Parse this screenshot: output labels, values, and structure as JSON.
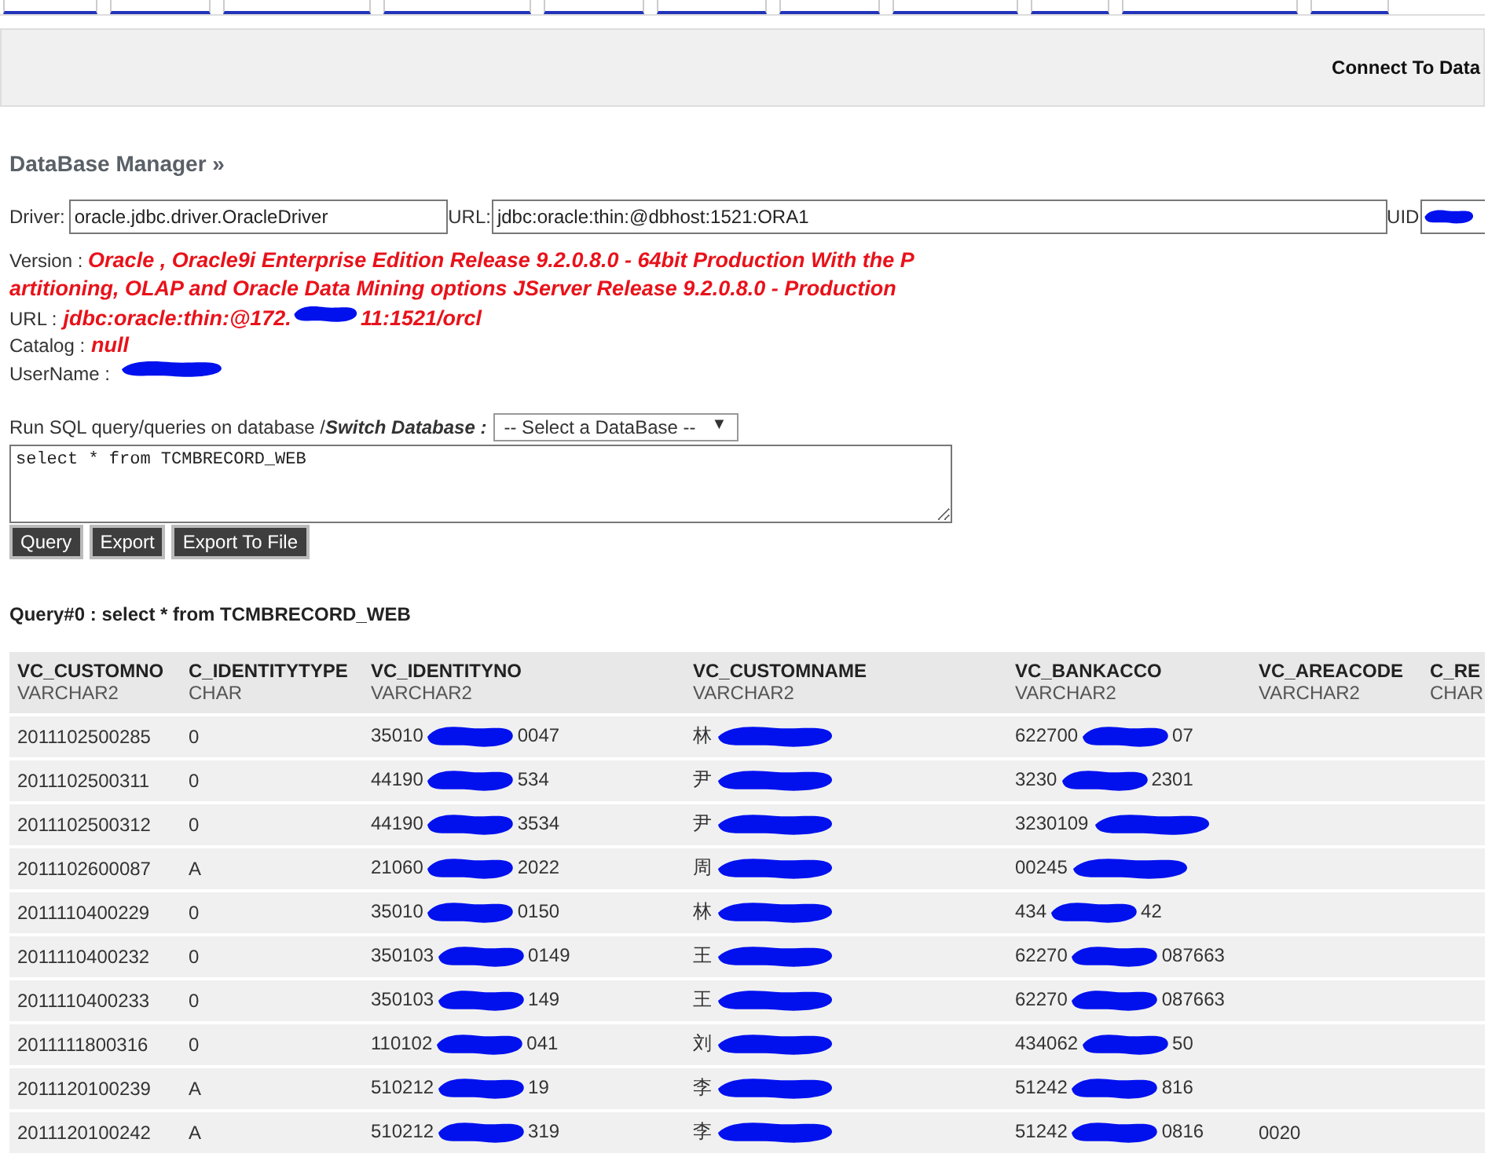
{
  "connect_bar": {
    "label": "Connect To Data"
  },
  "heading": "DataBase Manager »",
  "connection": {
    "driver_label": "Driver:",
    "driver": "oracle.jdbc.driver.OracleDriver",
    "url_label": "URL:",
    "url": "jdbc:oracle:thin:@dbhost:1521:ORA1",
    "uid_label": "UID"
  },
  "info": [
    {
      "label": "Version :",
      "before": "Oracle , Oracle9i Enterprise Edition Release 9.2.0.8.0 - 64bit Production With the P artitioning, OLAP and Oracle Data Mining options JServer Release 9.2.0.8.0 - Production",
      "redacted": false
    },
    {
      "label": "URL :",
      "before": "jdbc:oracle:thin:@172.",
      "after": "11:1521/orcl",
      "redacted": true
    },
    {
      "label": "Catalog :",
      "before": "null",
      "redacted": false
    },
    {
      "label": "UserName :",
      "redacted": true
    }
  ],
  "sql": {
    "prompt": "Run SQL query/queries on database / ",
    "switch_label": "Switch Database :",
    "select": "-- Select a DataBase --",
    "select_arrow": "▼",
    "query": "select * from TCMBRECORD_WEB",
    "buttons": [
      "Query",
      "Export",
      "Export To File"
    ]
  },
  "result_title": "Query#0 : select * from TCMBRECORD_WEB",
  "table": {
    "columns": [
      {
        "name": "VC_CUSTOMNO",
        "type": "VARCHAR2"
      },
      {
        "name": "C_IDENTITYTYPE",
        "type": "CHAR"
      },
      {
        "name": "VC_IDENTITYNO",
        "type": "VARCHAR2"
      },
      {
        "name": "VC_CUSTOMNAME",
        "type": "VARCHAR2"
      },
      {
        "name": "VC_BANKACCO",
        "type": "VARCHAR2"
      },
      {
        "name": "VC_AREACODE",
        "type": "VARCHAR2"
      },
      {
        "name": "C_RE",
        "type": "CHAR"
      }
    ],
    "rows": [
      {
        "cells": [
          "2011102500285",
          "0",
          {
            "before": "35010",
            "after": "0047"
          },
          {
            "before": "林"
          },
          {
            "before": "622700",
            "after": "07"
          },
          "",
          ""
        ]
      },
      {
        "cells": [
          "2011102500311",
          "0",
          {
            "before": "44190",
            "after": "534"
          },
          {
            "before": "尹"
          },
          {
            "before": "3230",
            "after": "2301"
          },
          "",
          ""
        ]
      },
      {
        "cells": [
          "2011102500312",
          "0",
          {
            "before": "44190",
            "after": "3534"
          },
          {
            "before": "尹"
          },
          {
            "before": "3230109"
          },
          "",
          ""
        ]
      },
      {
        "cells": [
          "2011102600087",
          "A",
          {
            "before": "21060",
            "after": "2022"
          },
          {
            "before": "周"
          },
          {
            "before": "00245"
          },
          "",
          ""
        ]
      },
      {
        "cells": [
          "2011110400229",
          "0",
          {
            "before": "35010",
            "after": "0150"
          },
          {
            "before": "林"
          },
          {
            "before": "434",
            "after": "42"
          },
          "",
          ""
        ]
      },
      {
        "cells": [
          "2011110400232",
          "0",
          {
            "before": "350103",
            "after": "0149"
          },
          {
            "before": "王"
          },
          {
            "before": "62270",
            "after": "087663"
          },
          "",
          ""
        ]
      },
      {
        "cells": [
          "2011110400233",
          "0",
          {
            "before": "350103",
            "after": "149"
          },
          {
            "before": "王"
          },
          {
            "before": "62270",
            "after": "087663"
          },
          "",
          ""
        ]
      },
      {
        "cells": [
          "2011111800316",
          "0",
          {
            "before": "110102",
            "after": "041"
          },
          {
            "before": "刘"
          },
          {
            "before": "434062",
            "after": "50"
          },
          "",
          ""
        ]
      },
      {
        "cells": [
          "2011120100239",
          "A",
          {
            "before": "510212",
            "after": "19"
          },
          {
            "before": "李"
          },
          {
            "before": "51242",
            "after": "816"
          },
          "",
          ""
        ]
      },
      {
        "cells": [
          "2011120100242",
          "A",
          {
            "before": "510212",
            "after": "319"
          },
          {
            "before": "李"
          },
          {
            "before": "51242",
            "after": "0816"
          },
          "0020",
          ""
        ]
      }
    ]
  }
}
